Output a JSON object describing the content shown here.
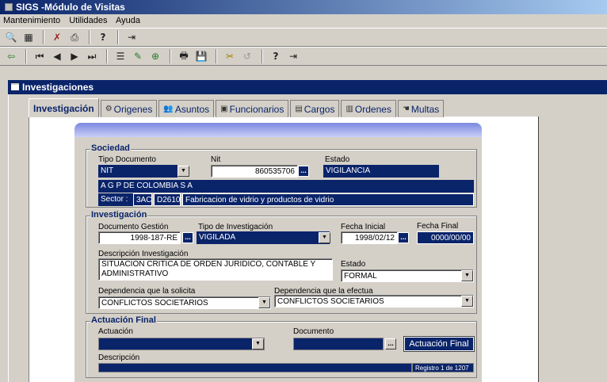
{
  "window": {
    "title": "SIGS -Módulo de Visitas"
  },
  "menu": [
    {
      "label": "Mantenimiento"
    },
    {
      "label": "Utilidades"
    },
    {
      "label": "Ayuda"
    }
  ],
  "toolbar1": {
    "icons": [
      "search-icon",
      "grid-icon",
      "tools-icon",
      "print-setup-icon",
      "help-icon",
      "exit-icon"
    ]
  },
  "toolbar2": {
    "icons": [
      "back-icon",
      "first-record-icon",
      "prev-record-icon",
      "next-record-icon",
      "last-record-icon",
      "list-icon",
      "edit-icon",
      "new-record-icon",
      "print-icon",
      "save-icon",
      "cut-icon",
      "undo-icon",
      "help-icon",
      "exit-icon"
    ]
  },
  "child_window": {
    "title": "Investigaciones"
  },
  "tabs": [
    {
      "label": "Investigación",
      "active": true
    },
    {
      "label": "Origenes"
    },
    {
      "label": "Asuntos"
    },
    {
      "label": "Funcionarios"
    },
    {
      "label": "Cargos"
    },
    {
      "label": "Ordenes"
    },
    {
      "label": "Multas"
    }
  ],
  "sociedad": {
    "legend": "Sociedad",
    "tipo_documento_label": "Tipo Documento",
    "tipo_documento_value": "NIT",
    "nit_label": "Nit",
    "nit_value": "860535706",
    "estado_label": "Estado",
    "estado_value": "VIGILANCIA",
    "razon_social": "A G P DE COLOMBIA S A",
    "sector_label": "Sector :",
    "sector_code": "3AC",
    "sector_sub": "D2610",
    "sector_desc": "Fabricacion de vidrio y productos de vidrio"
  },
  "investigacion": {
    "legend": "Investigación",
    "doc_gestion_label": "Documento Gestión",
    "doc_gestion_value": "1998-187-RE",
    "tipo_label": "Tipo de Investigación",
    "tipo_value": "VIGILADA",
    "fecha_inicial_label": "Fecha Inicial",
    "fecha_inicial_value": "1998/02/12",
    "fecha_final_label": "Fecha Final",
    "fecha_final_value": "0000/00/00",
    "descripcion_label": "Descripción Investigación",
    "descripcion_value": "SITUACION CRITICA DE ORDEN JURIDICO, CONTABLE Y ADMINISTRATIVO",
    "estado_label": "Estado",
    "estado_value": "FORMAL",
    "dep_solicita_label": "Dependencia que la solicita",
    "dep_solicita_value": "CONFLICTOS SOCIETARIOS",
    "dep_efectua_label": "Dependencia que la efectua",
    "dep_efectua_value": "CONFLICTOS SOCIETARIOS"
  },
  "actuacion": {
    "legend": "Actuación Final",
    "actuacion_label": "Actuación",
    "actuacion_value": "",
    "documento_label": "Documento",
    "documento_value": "",
    "button_label": "Actuación Final",
    "descripcion_label": "Descripción",
    "descripcion_value": ""
  },
  "status": {
    "record": "Registro 1 de 1207"
  },
  "colors": {
    "selection": "#0a246a",
    "panel": "#d4d0c8",
    "header_gradient_start": "#7b89e0"
  }
}
